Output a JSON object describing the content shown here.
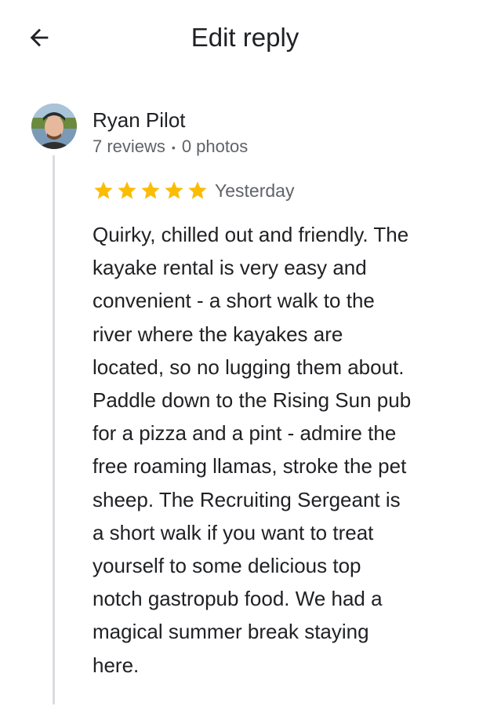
{
  "header": {
    "title": "Edit reply",
    "back_icon": "arrow-left-icon"
  },
  "review": {
    "author": "Ryan Pilot",
    "reviews_count": "7 reviews",
    "separator": "•",
    "photos_count": "0 photos",
    "rating": 5,
    "rating_max": 5,
    "date": "Yesterday",
    "text": "Quirky, chilled out and friendly. The\nkayake rental is very easy and\nconvenient - a short walk to the\nriver where the kayakes are\nlocated, so no lugging them about.\nPaddle down to the Rising Sun pub\nfor a pizza and a pint - admire the\nfree roaming llamas, stroke the pet\nsheep. The Recruiting Sergeant is\na short walk if you want to treat\nyourself to some delicious top\nnotch gastropub food. We had a\nmagical summer break staying\nhere.",
    "star_color": "#fbbc04"
  }
}
